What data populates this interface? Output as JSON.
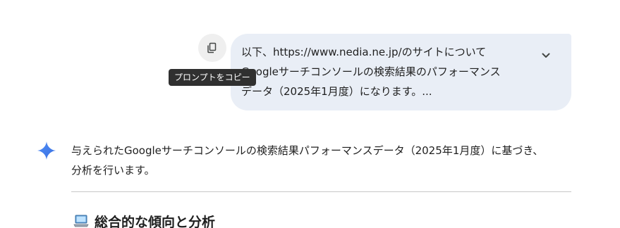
{
  "prompt": {
    "lines": [
      "以下、https://www.nedia.ne.jp/のサイトについて",
      "Googleサーチコンソールの検索結果のパフォーマンス",
      "データ（2025年1月度）になります。..."
    ],
    "copy_tooltip": "プロンプトをコピー",
    "copy_icon": "copy-icon",
    "expand_icon": "chevron-down-icon"
  },
  "response": {
    "icon": "gemini-sparkle-icon",
    "lines": [
      "与えられたGoogleサーチコンソールの検索結果パフォーマンスデータ（2025年1月度）に基づき、",
      "分析を行います。"
    ],
    "section_heading": {
      "icon": "laptop-icon",
      "text": "総合的な傾向と分析"
    }
  },
  "colors": {
    "bubble_bg": "#e9eef6",
    "tooltip_bg": "#303030",
    "gemini_blue": "#4285f4",
    "divider": "#c7c7c7"
  }
}
